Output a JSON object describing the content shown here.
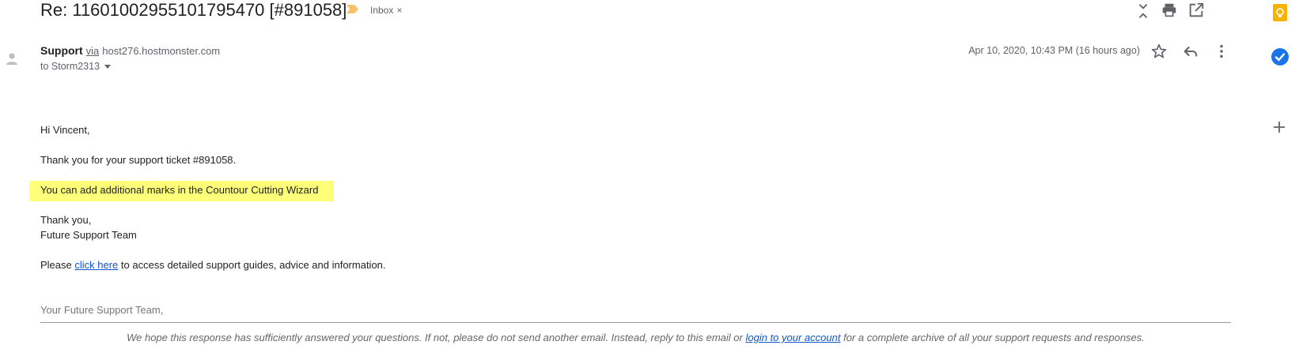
{
  "subject": "Re: 11601002955101795470 [#891058]",
  "label_chip": {
    "text": "Inbox",
    "remove": "×"
  },
  "toolbar": {
    "icons": [
      "collapse-icon",
      "print-icon",
      "open-in-new-window-icon"
    ]
  },
  "message": {
    "sender_name": "Support",
    "via": "via",
    "via_domain": "host276.hostmonster.com",
    "to_line": "to Storm2313",
    "date": "Apr 10, 2020, 10:43 PM (16 hours ago)",
    "actions": [
      "star-icon",
      "reply-icon",
      "more-options-icon"
    ]
  },
  "body": {
    "greeting": "Hi Vincent,",
    "line1": "Thank you for your support ticket #891058.",
    "highlighted_line": "You can add additional marks in the Countour Cutting Wizard",
    "thanks": "Thank you,",
    "team": "Future Support Team",
    "please_prefix": "Please",
    "please_link": "click here",
    "please_suffix": "to access detailed support guides, advice and information."
  },
  "signoff": "Your Future Support Team,",
  "footer": {
    "prefix": "We hope this response has sufficiently answered your questions. If not, please do not send another email. Instead, reply to this email or",
    "link": "login to your account",
    "suffix": "for a complete archive of all your support requests and responses."
  },
  "side_panel": {
    "icons": [
      "keep-icon",
      "tasks-icon",
      "add-icon"
    ],
    "colors": {
      "keep": "#f6b400",
      "tasks": "#1a73e8"
    }
  },
  "colors": {
    "highlight": "#ffff7a",
    "link": "#1155cc",
    "label_chip": "#f6c26b"
  }
}
